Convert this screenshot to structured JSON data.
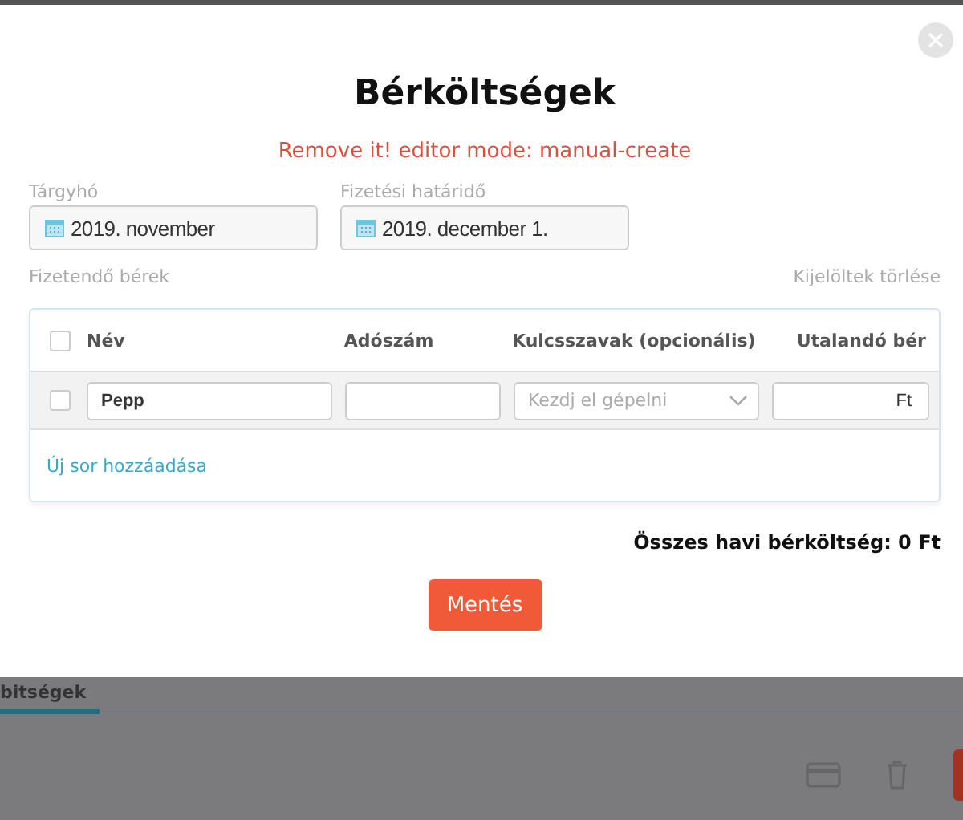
{
  "modal": {
    "title": "Bérköltségek",
    "notice": "Remove it! editor mode: manual-create",
    "fields": [
      {
        "label": "Tárgyhó",
        "value": "2019. november"
      },
      {
        "label": "Fizetési határidő",
        "value": "2019. december 1."
      }
    ],
    "section_label": "Fizetendő bérek",
    "clear_selected": "Kijelöltek törlése",
    "table": {
      "select_all": {
        "checked": false
      },
      "columns": [
        "Név",
        "Adószám",
        "Kulcsszavak (opcionális)",
        "Utalandó bér"
      ],
      "rows": [
        {
          "checked": false,
          "name": "Pepp",
          "tax_number": "",
          "keywords_placeholder": "Kezdj el gépelni",
          "amount_suffix": "Ft"
        }
      ],
      "add_row": "Új sor hozzáadása"
    },
    "total": "Összes havi bérköltség: 0 Ft",
    "save_button": "Mentés"
  },
  "background": {
    "tab": {
      "label": "bitségek",
      "selected": true
    }
  }
}
